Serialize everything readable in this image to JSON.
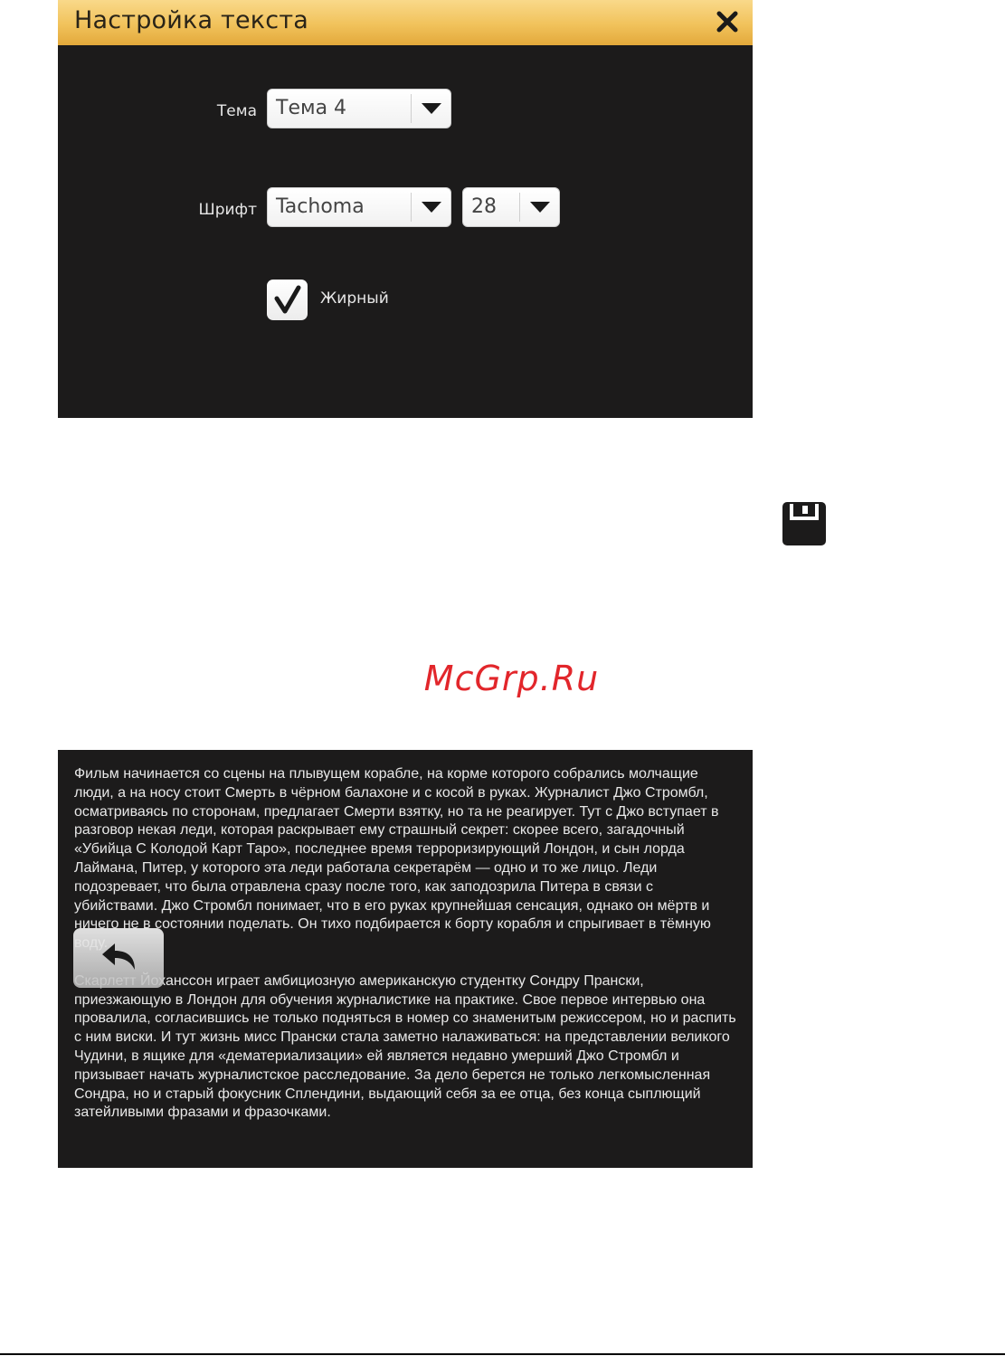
{
  "dialog": {
    "title": "Настройка текста",
    "theme_label": "Тема",
    "theme_value": "Тема 4",
    "font_label": "Шрифт",
    "font_value": "Tachoma",
    "size_value": "28",
    "bold_label": "Жирный",
    "bold_checked": true
  },
  "watermark": "McGrp.Ru",
  "preview": {
    "text": "Фильм начинается со сцены на плывущем корабле, на корме которого собрались молчащие люди, а на носу стоит Смерть в чёрном балахоне и с косой в руках. Журналист Джо Стромбл, осматриваясь по сторонам, предлагает Смерти взятку, но та не реагирует. Тут с Джо вступает в разговор некая леди, которая раскрывает ему страшный секрет: скорее всего, загадочный «Убийца С Колодой Карт Таро», последнее время терроризирующий Лондон, и сын лорда Лаймана, Питер, у которого эта леди работала секретарём — одно и то же лицо. Леди подозревает, что была отравлена сразу после того, как заподозрила Питера в связи с убийствами. Джо Стромбл понимает, что в его руках крупнейшая сенсация, однако он мёртв и ничего не в состоянии поделать. Он тихо подбирается к борту корабля и спрыгивает в тёмную воду.\n\nСкарлетт Йоханссон играет амбициозную американскую студентку Сондру Прански, приезжающую в Лондон для обучения журналистике на практике. Свое первое интервью она провалила, согласившись не только подняться в номер со знаменитым режиссером, но и распить с ним виски. И тут жизнь мисс Прански стала заметно налаживаться: на представлении великого Чудини, в ящике для «дематериализации» ей является недавно умерший Джо Стромбл и призывает начать журналистское расследование. За дело берется не только легкомысленная Сондра, но и старый фокусник Сплендини, выдающий себя за ее отца, без конца сыплющий затейливыми фразами и фразочками."
  },
  "icons": {
    "close": "close-icon",
    "dropdown": "chevron-down-icon",
    "check": "checkmark-icon",
    "save": "save-icon",
    "back": "undo-arrow-icon"
  },
  "colors": {
    "header_gradient_top": "#f9d98a",
    "header_gradient_bottom": "#e3a93b",
    "panel_bg": "#1c1b1b",
    "watermark": "#e2262b"
  }
}
